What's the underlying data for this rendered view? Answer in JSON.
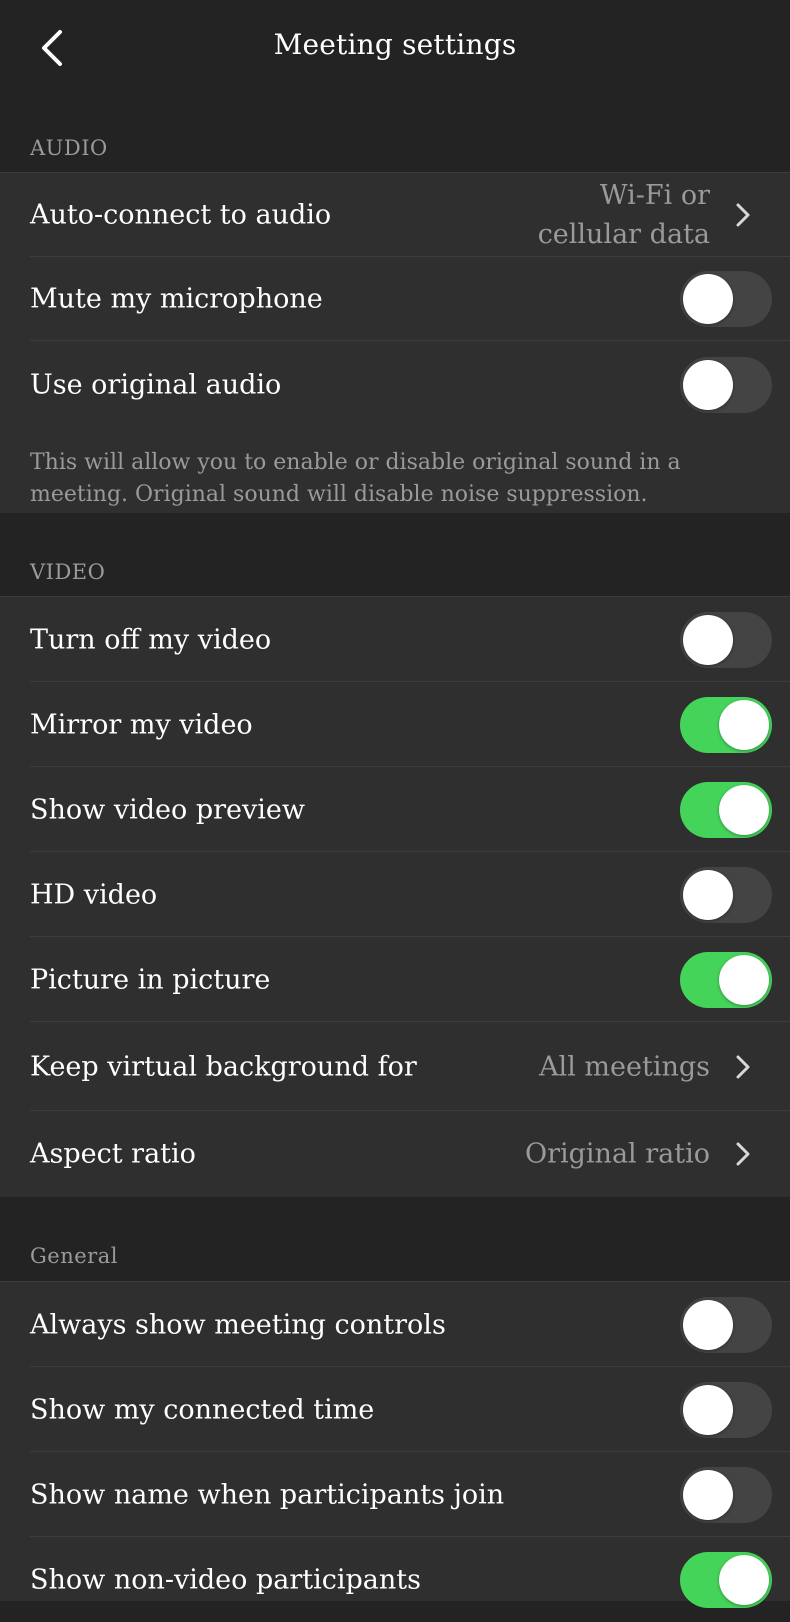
{
  "header": {
    "title": "Meeting settings",
    "back_icon": "chevron-left-icon"
  },
  "audio": {
    "label": "AUDIO",
    "auto_connect": {
      "label": "Auto-connect to audio",
      "value_line1": "Wi-Fi or",
      "value_line2": "cellular data"
    },
    "mute_mic": {
      "label": "Mute my microphone",
      "on": false
    },
    "original_audio": {
      "label": "Use original audio",
      "on": false
    },
    "note": "This will allow you to enable or disable original sound in a meeting. Original sound will disable noise suppression."
  },
  "video": {
    "label": "VIDEO",
    "turn_off_video": {
      "label": "Turn off my video",
      "on": false
    },
    "mirror_video": {
      "label": "Mirror my video",
      "on": true
    },
    "show_preview": {
      "label": "Show video preview",
      "on": true
    },
    "hd_video": {
      "label": "HD video",
      "on": false
    },
    "pip": {
      "label": "Picture in picture",
      "on": true
    },
    "virtual_bg": {
      "label": "Keep virtual background for",
      "value": "All meetings"
    },
    "aspect_ratio": {
      "label": "Aspect ratio",
      "value": "Original ratio"
    }
  },
  "general": {
    "label": "General",
    "always_show_controls": {
      "label": "Always show meeting controls",
      "on": false
    },
    "connected_time": {
      "label": "Show my connected time",
      "on": false
    },
    "show_name_join": {
      "label": "Show name when participants join",
      "on": false
    },
    "non_video": {
      "label": "Show non-video participants",
      "on": true
    }
  },
  "colors": {
    "background": "#232323",
    "group_background": "#2f2f2f",
    "toggle_on": "#45d45a",
    "toggle_off": "#444444",
    "secondary_text": "#9a9a9a"
  }
}
